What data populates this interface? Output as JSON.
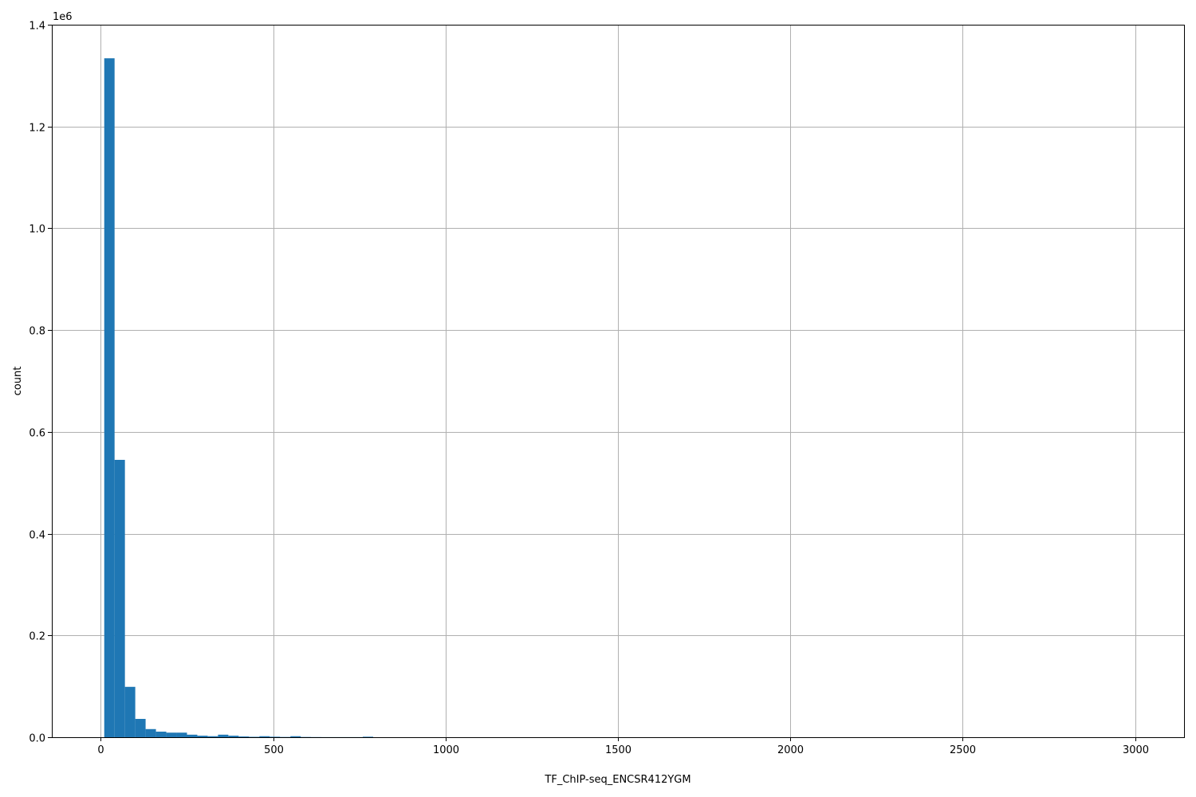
{
  "chart_data": {
    "type": "bar",
    "title": "",
    "xlabel": "TF_ChIP-seq_ENCSR412YGM",
    "ylabel": "count",
    "y_offset_text": "1e6",
    "xlim": [
      -142,
      3142
    ],
    "ylim": [
      0,
      1400000
    ],
    "grid": true,
    "color": "#1f77b4",
    "x_ticks": [
      0,
      500,
      1000,
      1500,
      2000,
      2500,
      3000
    ],
    "x_tick_labels": [
      "0",
      "500",
      "1000",
      "1500",
      "2000",
      "2500",
      "3000"
    ],
    "y_ticks": [
      0,
      200000,
      400000,
      600000,
      800000,
      1000000,
      1200000,
      1400000
    ],
    "y_tick_labels": [
      "0.0",
      "0.2",
      "0.4",
      "0.6",
      "0.8",
      "1.0",
      "1.2",
      "1.4"
    ],
    "bin_edges": [
      10,
      40,
      70,
      100,
      130,
      160,
      190,
      220,
      250,
      280,
      310,
      340,
      370,
      400,
      430,
      460,
      490,
      520,
      550,
      580,
      610,
      640,
      670,
      700,
      730,
      760,
      790
    ],
    "counts": [
      1334000,
      545000,
      99000,
      36000,
      16000,
      11000,
      9000,
      9000,
      5000,
      3000,
      2000,
      5000,
      3000,
      1500,
      800,
      2000,
      1000,
      500,
      2000,
      500,
      300,
      200,
      200,
      200,
      200,
      1000
    ]
  }
}
